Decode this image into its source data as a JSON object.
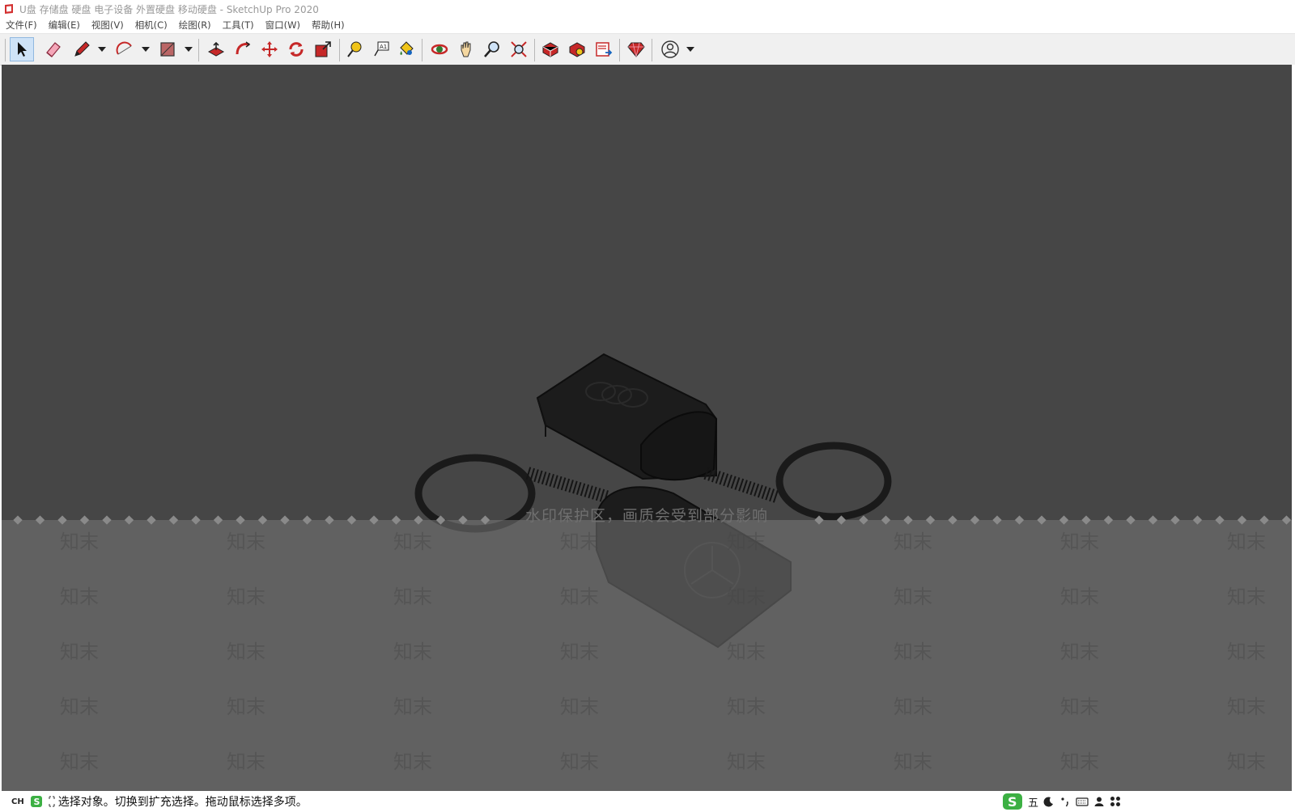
{
  "window": {
    "title": "U盘 存储盘 硬盘 电子设备 外置硬盘 移动硬盘 - SketchUp Pro 2020"
  },
  "menu": {
    "items": [
      {
        "label": "文件(F)"
      },
      {
        "label": "编辑(E)"
      },
      {
        "label": "视图(V)"
      },
      {
        "label": "相机(C)"
      },
      {
        "label": "绘图(R)"
      },
      {
        "label": "工具(T)"
      },
      {
        "label": "窗口(W)"
      },
      {
        "label": "帮助(H)"
      }
    ]
  },
  "toolbar": {
    "tools": [
      {
        "icon": "select-arrow-icon",
        "active": true
      },
      {
        "icon": "eraser-icon"
      },
      {
        "icon": "pencil-icon"
      },
      {
        "icon": "arc-icon"
      },
      {
        "icon": "rectangle-icon"
      },
      {
        "icon": "push-pull-icon"
      },
      {
        "icon": "follow-me-icon"
      },
      {
        "icon": "move-icon"
      },
      {
        "icon": "rotate-icon"
      },
      {
        "icon": "scale-icon"
      },
      {
        "icon": "tape-measure-icon"
      },
      {
        "icon": "text-icon"
      },
      {
        "icon": "paint-bucket-icon"
      },
      {
        "icon": "orbit-icon"
      },
      {
        "icon": "pan-icon"
      },
      {
        "icon": "zoom-icon"
      },
      {
        "icon": "zoom-extents-icon"
      },
      {
        "icon": "3d-warehouse-icon"
      },
      {
        "icon": "extension-warehouse-icon"
      },
      {
        "icon": "layout-icon"
      },
      {
        "icon": "ruby-console-icon"
      },
      {
        "icon": "account-icon"
      }
    ]
  },
  "viewport": {
    "background": "#464646",
    "watermark": {
      "banner": "水印保护区，画质会受到部分影响",
      "repeat_text": "知末"
    }
  },
  "statusbar": {
    "lang": "CH",
    "message": "选择对象。切换到扩充选择。拖动鼠标选择多项。",
    "ime_mode": "五"
  },
  "colors": {
    "accent": "#cfe3f7",
    "sketchup_red": "#d32f2f"
  }
}
